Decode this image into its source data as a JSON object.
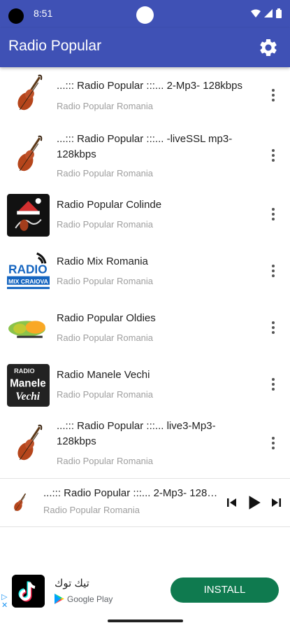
{
  "status": {
    "time": "8:51"
  },
  "app": {
    "title": "Radio Popular"
  },
  "stations": [
    {
      "title": "...::: Radio Popular :::... 2-Mp3- 128kbps",
      "subtitle": "Radio Popular Romania",
      "thumb": "violin"
    },
    {
      "title": "...::: Radio Popular :::... -liveSSL mp3-128kbps",
      "subtitle": "Radio Popular Romania",
      "thumb": "violin"
    },
    {
      "title": "Radio Popular Colinde",
      "subtitle": "Radio Popular Romania",
      "thumb": "colinde-logo"
    },
    {
      "title": "Radio Mix Romania",
      "subtitle": "Radio Popular Romania",
      "thumb": "radio-mix-craiova-logo",
      "logo_text_1": "RADIO",
      "logo_text_2": "MIX CRAIOVA"
    },
    {
      "title": "Radio Popular Oldies",
      "subtitle": "Radio Popular Romania",
      "thumb": "oldies-logo"
    },
    {
      "title": "Radio Manele Vechi",
      "subtitle": "Radio Popular Romania",
      "thumb": "manele-logo",
      "logo_text_1": "RADIO",
      "logo_text_2": "Manele",
      "logo_text_3": "Vechi"
    },
    {
      "title": "...::: Radio Popular :::... live3-Mp3-128kbps",
      "subtitle": "Radio Popular Romania",
      "thumb": "violin"
    }
  ],
  "player": {
    "title": "...::: Radio Popular :::... 2-Mp3- 128kbps",
    "subtitle": "Radio Popular Romania"
  },
  "ad": {
    "app_name": "تيك توك",
    "store": "Google Play",
    "install_label": "INSTALL"
  },
  "colors": {
    "primary": "#3f51b5",
    "install": "#0f7a4f"
  }
}
